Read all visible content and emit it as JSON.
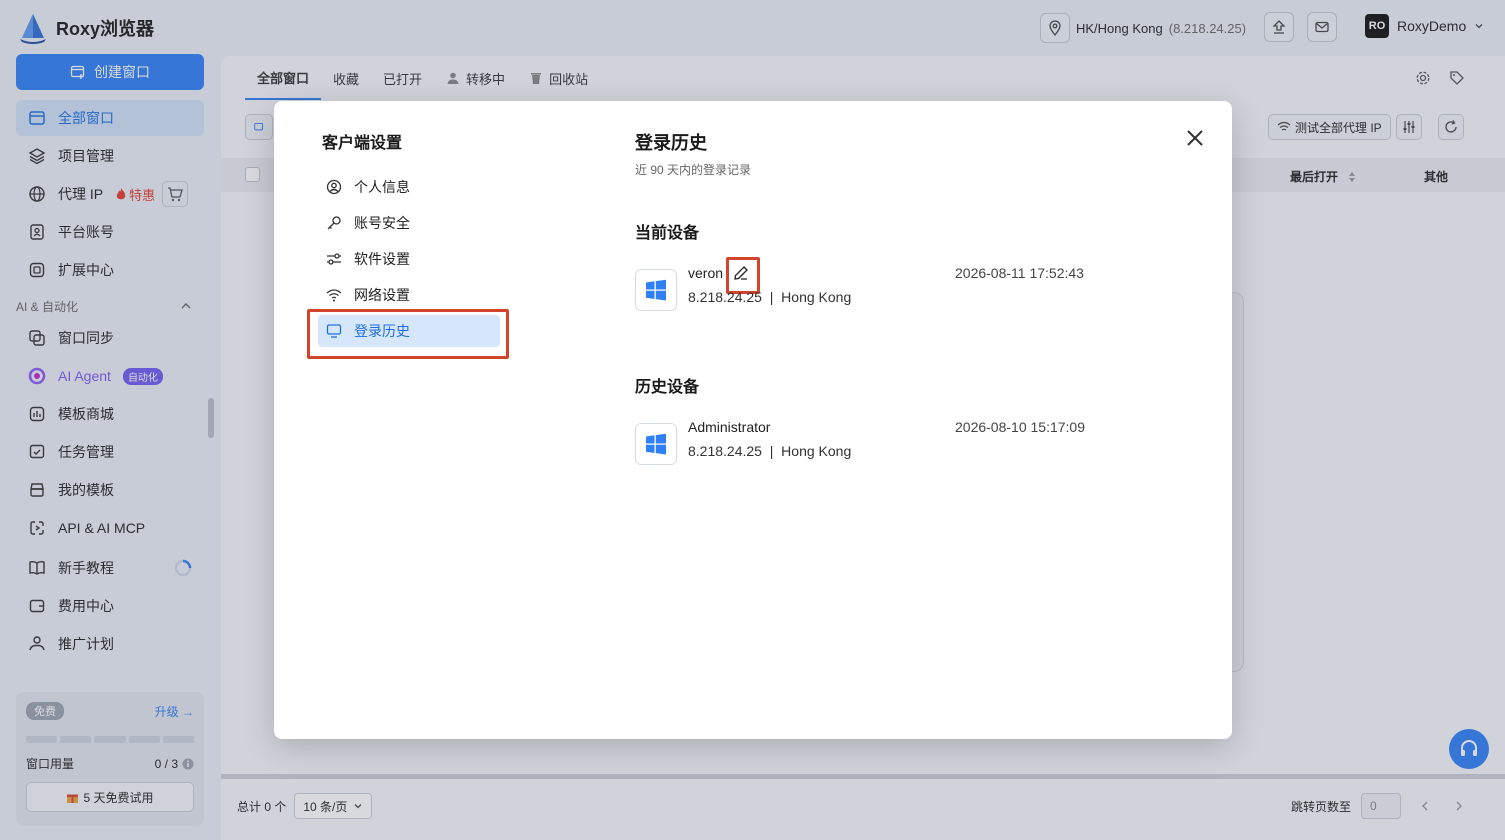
{
  "app": {
    "brand": "Roxy浏览器",
    "create_window": "创建窗口"
  },
  "sidebar": {
    "items": [
      {
        "label": "全部窗口"
      },
      {
        "label": "项目管理"
      },
      {
        "label": "代理 IP",
        "badge": "特惠"
      },
      {
        "label": "平台账号"
      },
      {
        "label": "扩展中心"
      }
    ],
    "section_ai": "AI & 自动化",
    "ai_items": [
      {
        "label": "窗口同步"
      },
      {
        "label": "AI Agent",
        "badge": "自动化"
      },
      {
        "label": "模板商城"
      },
      {
        "label": "任务管理"
      },
      {
        "label": "我的模板"
      },
      {
        "label": "API & AI MCP"
      },
      {
        "label": "新手教程"
      },
      {
        "label": "费用中心"
      },
      {
        "label": "推广计划"
      }
    ],
    "plan": {
      "tier": "免费",
      "upgrade": "升级",
      "usage_label": "窗口用量",
      "usage_value": "0 / 3",
      "trial": "5 天免费试用"
    }
  },
  "topbar": {
    "location": "HK/Hong Kong",
    "ip": "(8.218.24.25)",
    "avatar": "RO",
    "username": "RoxyDemo"
  },
  "main": {
    "tabs": [
      {
        "label": "全部窗口"
      },
      {
        "label": "收藏"
      },
      {
        "label": "已打开"
      },
      {
        "label": "转移中"
      },
      {
        "label": "回收站"
      }
    ],
    "test_proxy": "测试全部代理 IP",
    "columns": {
      "last_open": "最后打开",
      "other": "其他"
    },
    "footer": {
      "total": "总计 0 个",
      "page_size": "10 条/页",
      "jump_label": "跳转页数至",
      "jump_value": "0"
    }
  },
  "modal": {
    "side_title": "客户端设置",
    "menu": [
      {
        "label": "个人信息"
      },
      {
        "label": "账号安全"
      },
      {
        "label": "软件设置"
      },
      {
        "label": "网络设置"
      },
      {
        "label": "登录历史"
      }
    ],
    "title": "登录历史",
    "subtitle": "近 90 天内的登录记录",
    "current_title": "当前设备",
    "current_device": {
      "name": "veron",
      "ip": "8.218.24.25",
      "sep": "|",
      "location": "Hong Kong",
      "time": "2026-08-11 17:52:43"
    },
    "history_title": "历史设备",
    "history_devices": [
      {
        "name": "Administrator",
        "ip": "8.218.24.25",
        "sep": "|",
        "location": "Hong Kong",
        "time": "2026-08-10 15:17:09"
      }
    ]
  },
  "colors": {
    "accent": "#2f7ff7",
    "highlight": "#d2452c"
  }
}
